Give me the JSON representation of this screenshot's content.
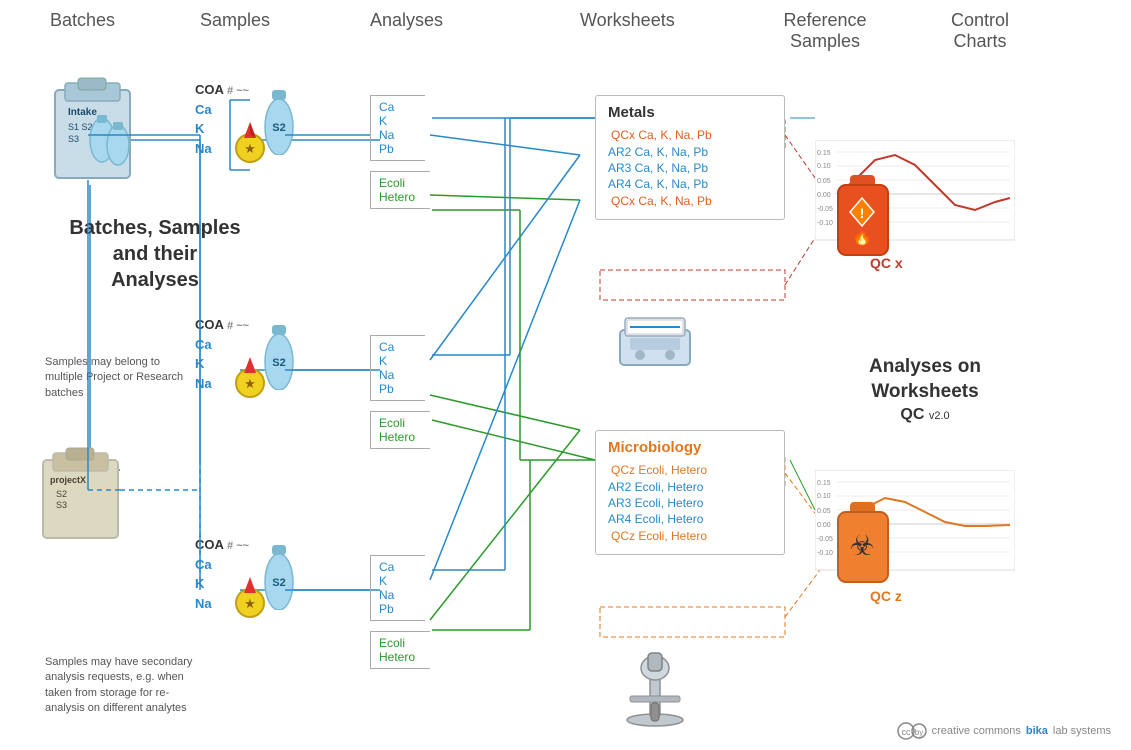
{
  "headers": {
    "batches": "Batches",
    "samples": "Samples",
    "analyses": "Analyses",
    "worksheets": "Worksheets",
    "reference_samples": "Reference\nSamples",
    "control_charts": "Control\nCharts"
  },
  "section_title": "Batches, Samples and their\nAnalyses",
  "analyses_worksheets_title": "Analyses on Worksheets",
  "analyses_worksheets_subtitle": "QC v2.0",
  "batch1": {
    "label": "Intake",
    "samples": "S1 S2\nS3"
  },
  "batch2": {
    "label": "projectX",
    "samples": "S2\nS3"
  },
  "coa_labels": [
    "COA #",
    "Ca",
    "K",
    "Na"
  ],
  "coa2_labels": [
    "COA #",
    "Ca",
    "K",
    "Na"
  ],
  "coa3_labels": [
    "COA #",
    "Ca",
    "K",
    "Na"
  ],
  "sample_label": "S2",
  "analysis_groups": {
    "group1_top": [
      "Ca",
      "K",
      "Na",
      "Pb"
    ],
    "group1_bottom": [
      "Ecoli",
      "Hetero"
    ],
    "group2_top": [
      "Ca",
      "K",
      "Na",
      "Pb"
    ],
    "group2_bottom": [
      "Ecoli",
      "Hetero"
    ],
    "group3_top": [
      "Ca",
      "K",
      "Na",
      "Pb"
    ],
    "group3_bottom": [
      "Ecoli",
      "Hetero"
    ]
  },
  "worksheets": {
    "metals": {
      "title": "Metals",
      "rows": [
        {
          "label": "QCx Ca, K, Na, Pb",
          "type": "qc"
        },
        {
          "label": "AR2 Ca, K, Na, Pb",
          "type": "ar"
        },
        {
          "label": "AR3 Ca, K, Na, Pb",
          "type": "ar"
        },
        {
          "label": "AR4 Ca, K, Na, Pb",
          "type": "ar"
        },
        {
          "label": "QCx Ca, K, Na, Pb",
          "type": "qc"
        }
      ]
    },
    "microbiology": {
      "title": "Microbiology",
      "rows": [
        {
          "label": "QCz Ecoli, Hetero",
          "type": "qc_orange"
        },
        {
          "label": "AR2 Ecoli, Hetero",
          "type": "ar"
        },
        {
          "label": "AR3 Ecoli, Hetero",
          "type": "ar"
        },
        {
          "label": "AR4 Ecoli, Hetero",
          "type": "ar"
        },
        {
          "label": "QCz Ecoli, Hetero",
          "type": "qc_orange"
        }
      ]
    }
  },
  "notes": {
    "note1": "Samples may belong to multiple Project or Research batches",
    "note2": "Samples may have secondary analysis requests, e.g. when taken from storage for re-analysis on different analytes"
  },
  "qc_labels": {
    "qcx": "QC x",
    "qcz": "QC z"
  },
  "footer": {
    "license": "creative commons",
    "brand": "bika lab systems"
  },
  "colors": {
    "blue": "#2888c8",
    "orange": "#e07820",
    "red": "#c0392b",
    "green": "#2a9a2a",
    "gray": "#aaa",
    "dark": "#333",
    "qc_red": "#e06020",
    "qc_orange": "#e07820"
  }
}
